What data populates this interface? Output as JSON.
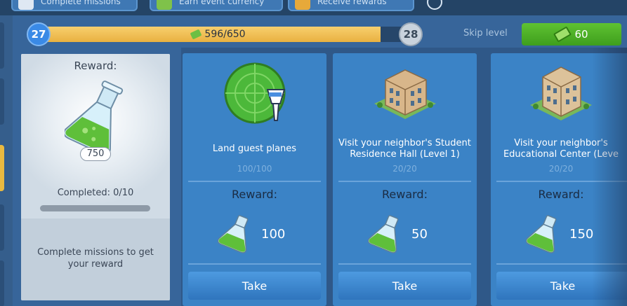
{
  "top_tabs": [
    {
      "label": "Complete missions",
      "icon": "missions-icon"
    },
    {
      "label": "Earn event currency",
      "icon": "currency-icon"
    },
    {
      "label": "Receive rewards",
      "icon": "rewards-icon"
    }
  ],
  "progress": {
    "current_level": "27",
    "next_level": "28",
    "value_text": "596/650",
    "fraction": 0.917
  },
  "skip": {
    "label": "Skip level",
    "cost": "60"
  },
  "reward_panel": {
    "title": "Reward:",
    "amount": "750",
    "completed": "Completed: 0/10",
    "hint": "Complete missions to get your reward"
  },
  "missions": [
    {
      "name": "Land guest planes",
      "count": "100/100",
      "reward_label": "Reward:",
      "reward_amount": "100",
      "take_label": "Take",
      "icon": "air-traffic-tower-icon"
    },
    {
      "name": "Visit your neighbor's Student Residence Hall (Level 1)",
      "count": "20/20",
      "reward_label": "Reward:",
      "reward_amount": "50",
      "take_label": "Take",
      "icon": "student-residence-hall-icon"
    },
    {
      "name": "Visit your neighbor's Educational Center (Leve",
      "count": "20/20",
      "reward_label": "Reward:",
      "reward_amount": "150",
      "take_label": "Take",
      "icon": "educational-center-icon"
    }
  ],
  "colors": {
    "accent_gold": "#e9b140",
    "skip_green": "#4fb028",
    "card_blue": "#3b83c6",
    "panel_grey": "#d0dbe5"
  }
}
